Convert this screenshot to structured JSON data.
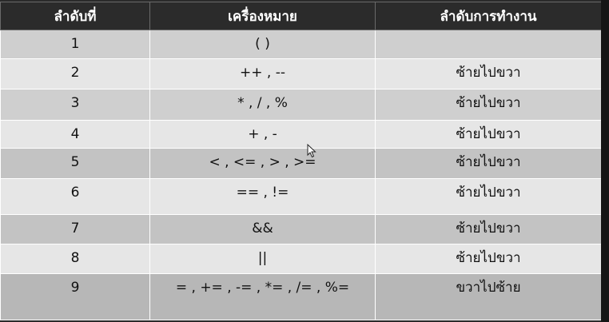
{
  "table": {
    "headers": [
      "ลำดับที่",
      "เครื่องหมาย",
      "ลำดับการทำงาน"
    ],
    "rows": [
      {
        "rank": "1",
        "operator": "( )",
        "associativity": ""
      },
      {
        "rank": "2",
        "operator": "++ ,  --",
        "associativity": "ซ้ายไปขวา"
      },
      {
        "rank": "3",
        "operator": "* ,  /   ,  %",
        "associativity": "ซ้ายไปขวา"
      },
      {
        "rank": "4",
        "operator": "+ ,  -",
        "associativity": "ซ้ายไปขวา"
      },
      {
        "rank": "5",
        "operator": "< ,  <= ,  > ,  >=",
        "associativity": "ซ้ายไปขวา"
      },
      {
        "rank": "6",
        "operator": "== ,  !=",
        "associativity": "ซ้ายไปขวา"
      },
      {
        "rank": "7",
        "operator": "&&",
        "associativity": "ซ้ายไปขวา"
      },
      {
        "rank": "8",
        "operator": "||",
        "associativity": "ซ้ายไปขวา"
      },
      {
        "rank": "9",
        "operator": "= ,  += ,  -= ,  *= ,  /= ,  %=",
        "associativity": "ขวาไปซ้าย"
      }
    ]
  },
  "cursor": {
    "icon": "mouse-pointer-icon"
  }
}
